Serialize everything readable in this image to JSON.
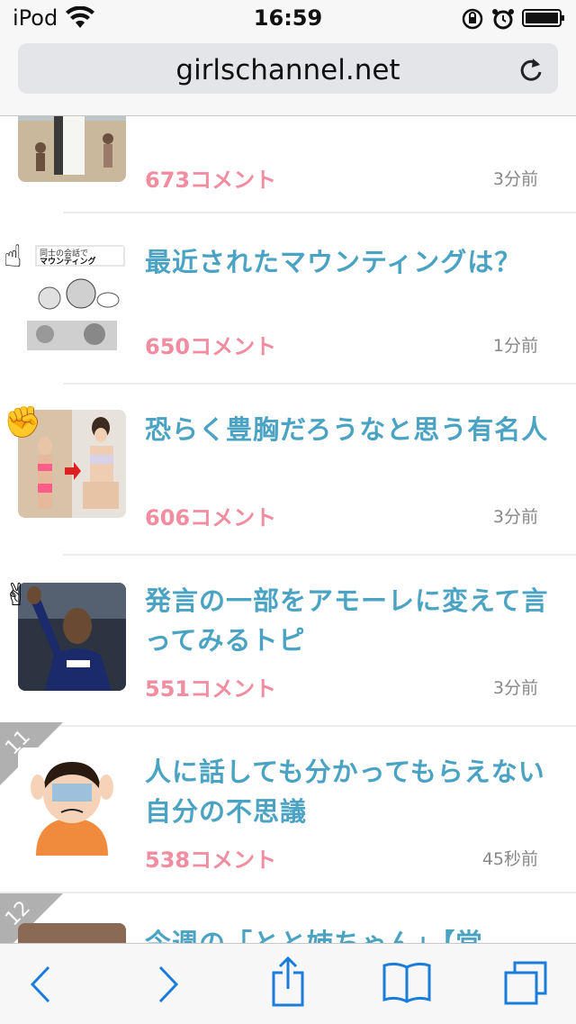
{
  "status": {
    "device": "iPod",
    "time": "16:59"
  },
  "browser": {
    "url": "girlschannel.net"
  },
  "topics": [
    {
      "title": "",
      "comments": "673コメント",
      "time": "3分前",
      "hand": ""
    },
    {
      "title": "最近されたマウンティングは？",
      "comments": "650コメント",
      "time": "1分前",
      "hand": "☝"
    },
    {
      "title": "恐らく豊胸だろうなと思う有名人",
      "comments": "606コメント",
      "time": "3分前",
      "hand": "✊"
    },
    {
      "title": "発言の一部をアモーレに変えて言ってみるトピ",
      "comments": "551コメント",
      "time": "3分前",
      "hand": "✌"
    },
    {
      "title": "人に話しても分かってもらえない自分の不思議",
      "comments": "538コメント",
      "time": "45秒前",
      "rank": "11"
    },
    {
      "title": "今週の「とと姉ちゃん」【堂",
      "rank": "12"
    }
  ],
  "colors": {
    "title": "#4ba3c3",
    "comments": "#f28ca0",
    "toolbar_icon": "#1a7cdb"
  }
}
